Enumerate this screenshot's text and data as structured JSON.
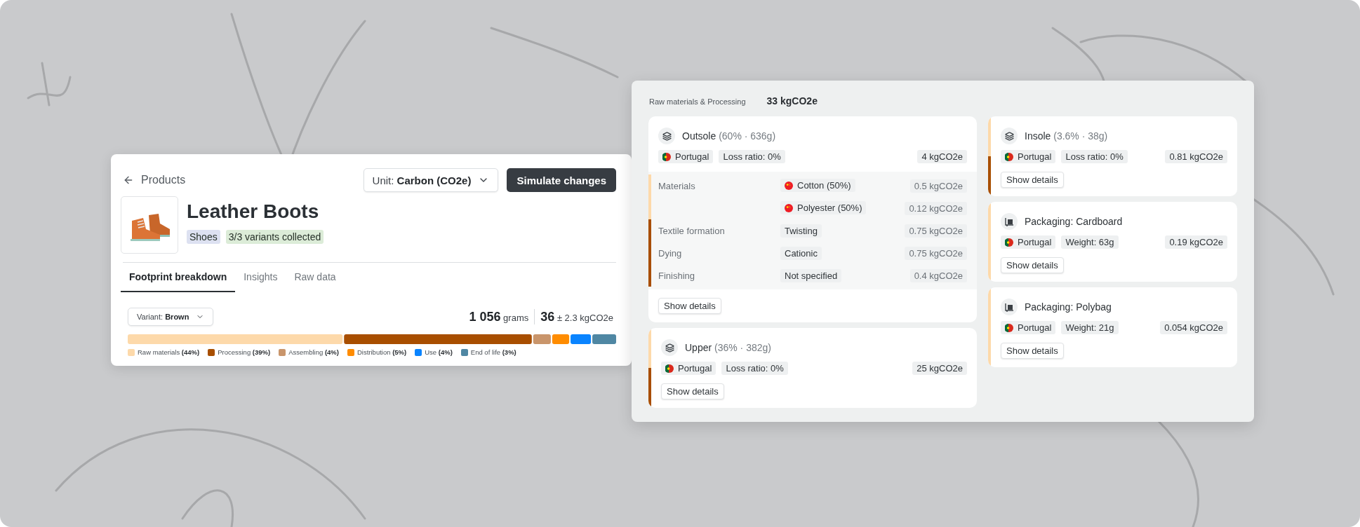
{
  "product_card": {
    "back_link": "Products",
    "unit_select": {
      "label": "Unit:",
      "value": "Carbon (CO2e)"
    },
    "simulate_button": "Simulate changes",
    "title": "Leather Boots",
    "tags": [
      {
        "label": "Shoes",
        "color": "#dde1f1"
      },
      {
        "label": "3/3 variants collected",
        "color": "#dcecd8"
      }
    ],
    "tabs": [
      {
        "label": "Footprint breakdown",
        "selected": true
      },
      {
        "label": "Insights",
        "selected": false
      },
      {
        "label": "Raw data",
        "selected": false
      }
    ],
    "variant_select": {
      "label": "Variant:",
      "value": "Brown"
    },
    "weight": {
      "value": "1 056",
      "unit": "grams"
    },
    "emissions": {
      "value": "36",
      "uncertainty": "± 2.3 kgCO2e"
    },
    "breakdown": [
      {
        "label": "Raw materials **(44%)**",
        "color": "#fdd9aa"
      },
      {
        "label": "Processing **(39%)**",
        "color": "#a84e00"
      },
      {
        "label": "Assembling **(4%)**",
        "color": "#c9956b"
      },
      {
        "label": "Distribution **(5%)**",
        "color": "#ff8c00"
      },
      {
        "label": "Use **(4%)**",
        "color": "#0a84ff"
      },
      {
        "label": "End of life **(3%)**",
        "color": "#4f87a3"
      }
    ]
  },
  "detail_panel": {
    "title": "Raw materials & Processing",
    "total": "33 kgCO2e",
    "columns": [
      [
        {
          "kind": "layers",
          "name": "Outsole",
          "meta": "(60% · 636g)",
          "chips": [
            {
              "kind": "pt",
              "text": "Portugal"
            },
            {
              "text": "Loss ratio: 0%"
            }
          ],
          "total": "4 kgCO2e",
          "details": [
            {
              "label": "Materials",
              "color": "#fdd9aa",
              "items": [
                {
                  "kind": "cn",
                  "text": "Cotton (50%)",
                  "value": "0.5 kgCO2e"
                },
                {
                  "kind": "cn",
                  "text": "Polyester (50%)",
                  "value": "0.12 kgCO2e"
                }
              ]
            },
            {
              "label": "Textile formation",
              "color": "#a84e00",
              "items": [
                {
                  "text": "Twisting",
                  "value": "0.75 kgCO2e"
                }
              ]
            },
            {
              "label": "Dying",
              "color": "#a84e00",
              "items": [
                {
                  "text": "Cationic",
                  "value": "0.75 kgCO2e"
                }
              ]
            },
            {
              "label": "Finishing",
              "color": "#a84e00",
              "items": [
                {
                  "text": "Not specified",
                  "value": "0.4 kgCO2e"
                }
              ]
            }
          ],
          "button": "Show details"
        },
        {
          "kind": "layers",
          "name": "Upper",
          "meta": "(36% · 382g)",
          "stripe": [
            {
              "color": "#fdd9aa"
            },
            {
              "color": "#a84e00"
            }
          ],
          "chips": [
            {
              "kind": "pt",
              "text": "Portugal"
            },
            {
              "text": "Loss ratio: 0%"
            }
          ],
          "total": "25 kgCO2e",
          "button": "Show details"
        }
      ],
      [
        {
          "kind": "layers",
          "name": "Insole",
          "meta": "(3.6% · 38g)",
          "stripe": [
            {
              "color": "#fdd9aa"
            },
            {
              "color": "#a84e00"
            }
          ],
          "chips": [
            {
              "kind": "pt",
              "text": "Portugal"
            },
            {
              "text": "Loss ratio: 0%"
            }
          ],
          "total": "0.81 kgCO2e",
          "button": "Show details"
        },
        {
          "kind": "packaging",
          "name": "Packaging: Cardboard",
          "stripe": [
            {
              "color": "#fdd9aa"
            }
          ],
          "chips": [
            {
              "kind": "pt",
              "text": "Portugal"
            },
            {
              "text": "Weight: 63g"
            }
          ],
          "total": "0.19 kgCO2e",
          "button": "Show details"
        },
        {
          "kind": "packaging",
          "name": "Packaging: Polybag",
          "stripe": [
            {
              "color": "#fdd9aa"
            }
          ],
          "chips": [
            {
              "kind": "pt",
              "text": "Portugal"
            },
            {
              "text": "Weight: 21g"
            }
          ],
          "total": "0.054 kgCO2e",
          "button": "Show details"
        }
      ]
    ]
  }
}
